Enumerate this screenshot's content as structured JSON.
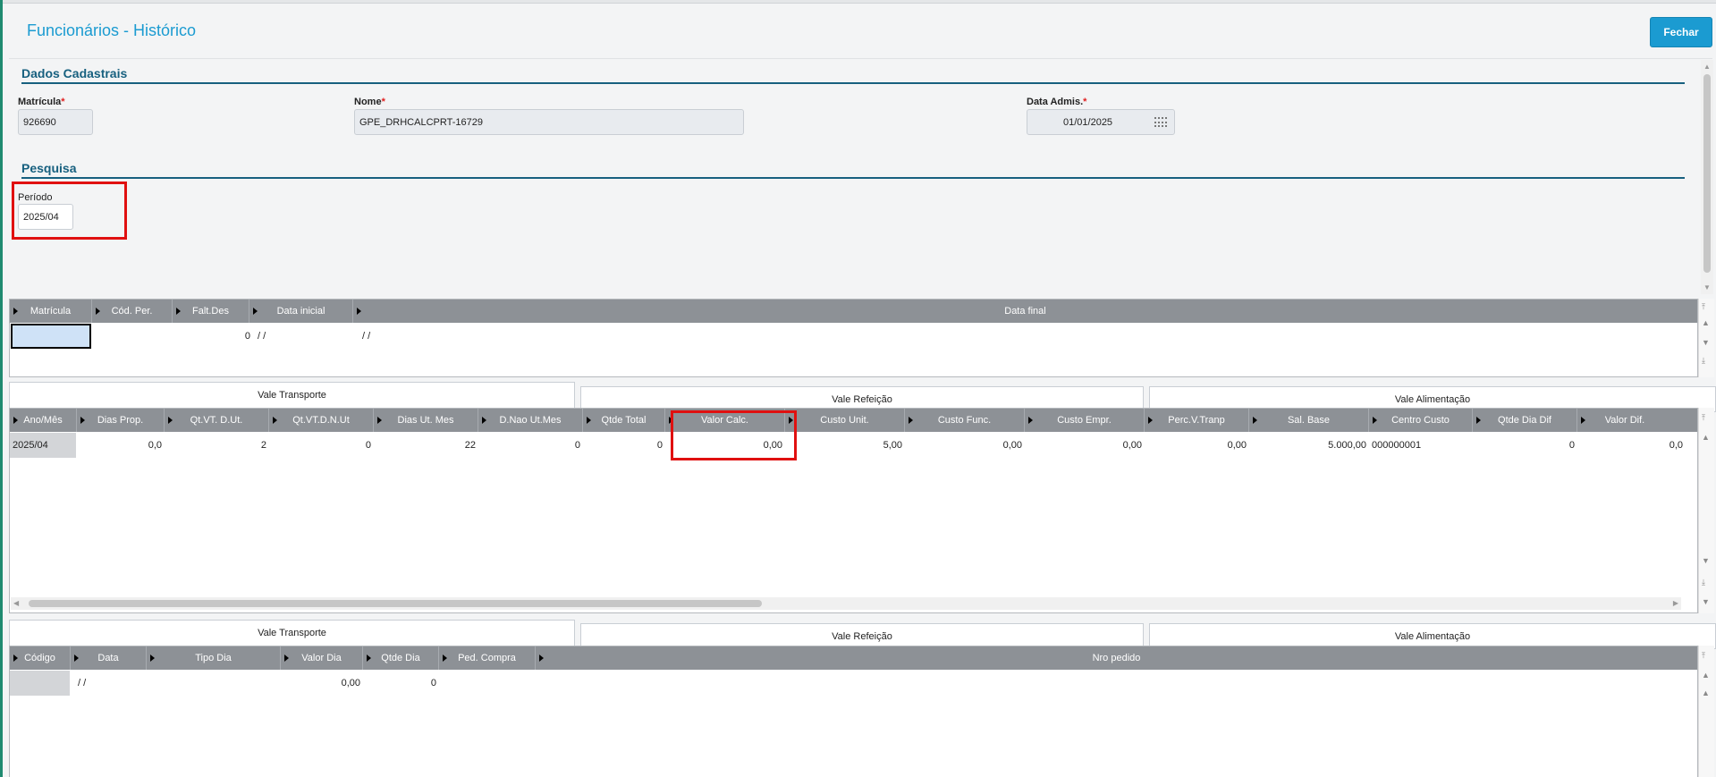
{
  "header": {
    "title": "Funcionários - Histórico",
    "close_label": "Fechar"
  },
  "dados": {
    "section_title": "Dados Cadastrais",
    "matricula_label": "Matrícula",
    "matricula_value": "926690",
    "nome_label": "Nome",
    "nome_value": "GPE_DRHCALCPRT-16729",
    "admis_label": "Data Admis.",
    "admis_value": "01/01/2025",
    "required_mark": "*"
  },
  "pesquisa": {
    "section_title": "Pesquisa",
    "periodo_label": "Período",
    "periodo_value": "2025/04"
  },
  "grid1": {
    "columns": [
      "Matrícula",
      "Cód. Per.",
      "Falt.Des",
      "Data inicial",
      "Data final"
    ],
    "row": {
      "falt_des": "0",
      "data_inicial": "/  /",
      "data_final": "/  /"
    }
  },
  "tabs1": [
    "Vale Transporte",
    "Vale Refeição",
    "Vale Alimentação"
  ],
  "grid2": {
    "columns": [
      "Ano/Mês",
      "Dias Prop.",
      "Qt.VT. D.Ut.",
      "Qt.VT.D.N.Ut",
      "Dias Ut. Mes",
      "D.Nao Ut.Mes",
      "Qtde Total",
      "Valor Calc.",
      "Custo Unit.",
      "Custo Func.",
      "Custo Empr.",
      "Perc.V.Tranp",
      "Sal. Base",
      "Centro Custo",
      "Qtde Dia Dif",
      "Valor Dif."
    ],
    "row": [
      "2025/04",
      "0,0",
      "2",
      "0",
      "22",
      "0",
      "0",
      "0,00",
      "5,00",
      "0,00",
      "0,00",
      "0,00",
      "5.000,00",
      "000000001",
      "0",
      "0,0"
    ]
  },
  "tabs2": [
    "Vale Transporte",
    "Vale Refeição",
    "Vale Alimentação"
  ],
  "grid3": {
    "columns": [
      "Código",
      "Data",
      "Tipo Dia",
      "Valor Dia",
      "Qtde Dia",
      "Ped. Compra",
      "Nro pedido"
    ],
    "row": {
      "data": "/  /",
      "valor_dia": "0,00",
      "qtde_dia": "0"
    }
  },
  "colors": {
    "accent": "#1b9bd1",
    "section": "#17607f",
    "highlight": "#e01010",
    "grid_header": "#8d9196"
  }
}
